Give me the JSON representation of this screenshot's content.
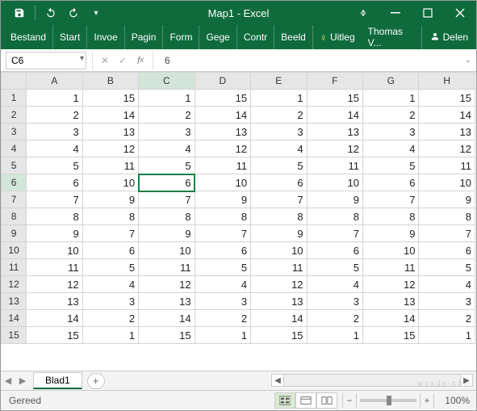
{
  "window": {
    "title": "Map1 - Excel"
  },
  "ribbon": {
    "tabs": [
      "Bestand",
      "Start",
      "Invoe",
      "Pagin",
      "Form",
      "Gege",
      "Contr",
      "Beeld"
    ],
    "tell_me": "Uitleg",
    "user": "Thomas V...",
    "share": "Delen"
  },
  "formula_bar": {
    "name_box": "C6",
    "formula_value": "6"
  },
  "grid": {
    "columns": [
      "A",
      "B",
      "C",
      "D",
      "E",
      "F",
      "G",
      "H"
    ],
    "rows": [
      {
        "n": "1",
        "v": [
          "1",
          "15",
          "1",
          "15",
          "1",
          "15",
          "1",
          "15"
        ]
      },
      {
        "n": "2",
        "v": [
          "2",
          "14",
          "2",
          "14",
          "2",
          "14",
          "2",
          "14"
        ]
      },
      {
        "n": "3",
        "v": [
          "3",
          "13",
          "3",
          "13",
          "3",
          "13",
          "3",
          "13"
        ]
      },
      {
        "n": "4",
        "v": [
          "4",
          "12",
          "4",
          "12",
          "4",
          "12",
          "4",
          "12"
        ]
      },
      {
        "n": "5",
        "v": [
          "5",
          "11",
          "5",
          "11",
          "5",
          "11",
          "5",
          "11"
        ]
      },
      {
        "n": "6",
        "v": [
          "6",
          "10",
          "6",
          "10",
          "6",
          "10",
          "6",
          "10"
        ]
      },
      {
        "n": "7",
        "v": [
          "7",
          "9",
          "7",
          "9",
          "7",
          "9",
          "7",
          "9"
        ]
      },
      {
        "n": "8",
        "v": [
          "8",
          "8",
          "8",
          "8",
          "8",
          "8",
          "8",
          "8"
        ]
      },
      {
        "n": "9",
        "v": [
          "9",
          "7",
          "9",
          "7",
          "9",
          "7",
          "9",
          "7"
        ]
      },
      {
        "n": "10",
        "v": [
          "10",
          "6",
          "10",
          "6",
          "10",
          "6",
          "10",
          "6"
        ]
      },
      {
        "n": "11",
        "v": [
          "11",
          "5",
          "11",
          "5",
          "11",
          "5",
          "11",
          "5"
        ]
      },
      {
        "n": "12",
        "v": [
          "12",
          "4",
          "12",
          "4",
          "12",
          "4",
          "12",
          "4"
        ]
      },
      {
        "n": "13",
        "v": [
          "13",
          "3",
          "13",
          "3",
          "13",
          "3",
          "13",
          "3"
        ]
      },
      {
        "n": "14",
        "v": [
          "14",
          "2",
          "14",
          "2",
          "14",
          "2",
          "14",
          "2"
        ]
      },
      {
        "n": "15",
        "v": [
          "15",
          "1",
          "15",
          "1",
          "15",
          "1",
          "15",
          "1"
        ]
      }
    ],
    "selected": {
      "row_idx": 5,
      "col_idx": 2
    }
  },
  "sheets": {
    "active": "Blad1"
  },
  "statusbar": {
    "ready": "Gereed",
    "zoom": "100%"
  },
  "watermark": {
    "line1": "wsxdn.com"
  }
}
